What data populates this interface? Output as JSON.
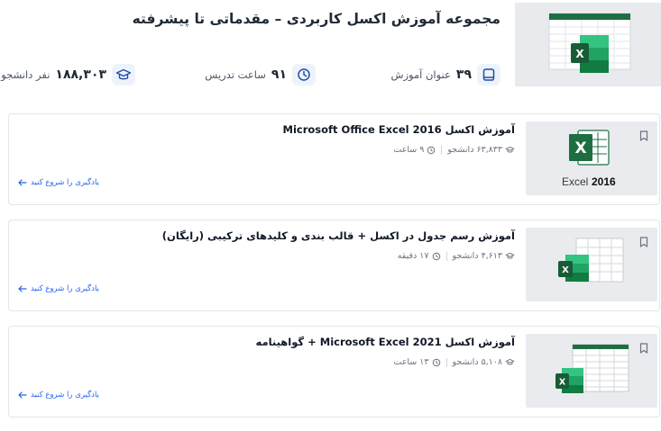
{
  "header": {
    "title": "مجموعه آموزش اکسل کاربردی – مقدماتی تا پیشرفته",
    "stats": {
      "courses_count": "۳۹",
      "courses_label": "عنوان آموزش",
      "hours_count": "۹۱",
      "hours_label": "ساعت تدریس",
      "students_count": "۱۸۸,۳۰۳",
      "students_label": "نفر دانشجو"
    }
  },
  "courses": [
    {
      "title": "آموزش اکسل Microsoft Office Excel 2016",
      "students": "۶۳,۸۳۳ دانشجو",
      "duration": "۹ ساعت",
      "cta": "یادگیری را شروع کنید",
      "thumb_caption": "Excel",
      "thumb_year": "2016"
    },
    {
      "title": "آموزش رسم جدول در اکسل + قالب بندی و کلیدهای ترکیبی (رایگان)",
      "students": "۴,۶۱۳ دانشجو",
      "duration": "۱۷ دقیقه",
      "cta": "یادگیری را شروع کنید"
    },
    {
      "title": "آموزش اکسل Microsoft Excel 2021 + گواهینامه",
      "students": "۵,۱۰۸ دانشجو",
      "duration": "۱۳ ساعت",
      "cta": "یادگیری را شروع کنید"
    }
  ],
  "colors": {
    "excel_green": "#1d6f42",
    "link_blue": "#2563eb",
    "icon_blue": "#1e4fa8"
  },
  "icons": [
    "book-icon",
    "clock-icon",
    "graduation-cap-icon",
    "bookmark-icon",
    "arrow-left-icon",
    "excel-logo-icon"
  ]
}
